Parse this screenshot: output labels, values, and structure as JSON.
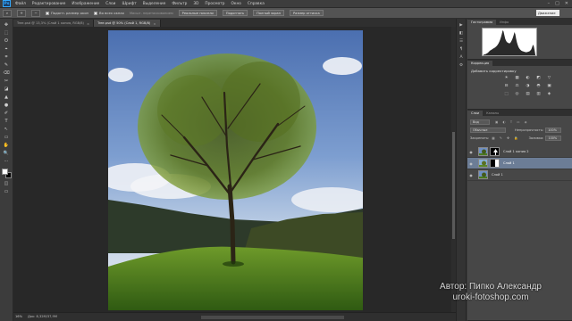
{
  "app": {
    "logo": "Ps"
  },
  "menu": [
    "Файл",
    "Редактирование",
    "Изображение",
    "Слои",
    "Шрифт",
    "Выделение",
    "Фильтр",
    "3D",
    "Просмотр",
    "Окно",
    "Справка"
  ],
  "window_controls": [
    "–",
    "□",
    "✕"
  ],
  "options_bar": {
    "tool_icon": "zoom-icon",
    "check_resize": "Подогн. размер окон",
    "check_all": "Во всех окнах",
    "scrubby_label": "Масшт. перетаскиванием",
    "btn_actual": "Реальные пиксели",
    "btn_fit": "Подогнать",
    "btn_fill": "Полный экран",
    "btn_print": "Размер оттиска",
    "workspace": "Движение"
  },
  "tools": [
    "✥",
    "⬚",
    "ʘ",
    "⌖",
    "⌗",
    "✎",
    "⌫",
    "✂",
    "◪",
    "▲",
    "●",
    "✐",
    "T",
    "↖",
    "▭",
    "✋",
    "🔍",
    "⋯"
  ],
  "tabs": [
    {
      "label": "Tree.psd @ 13,3% (Слой 1 копия, RGB/8)",
      "active": false,
      "close": "×"
    },
    {
      "label": "Tree.psd @ 50% (Слой 1, RGB/8)",
      "active": true,
      "close": "×"
    }
  ],
  "status": {
    "zoom": "16%",
    "doc": "Док: 8,32M/37,9M"
  },
  "panel_strip_icons": [
    "▶",
    "◧",
    "☰",
    "¶",
    "A",
    "⚙"
  ],
  "histogram_panel": {
    "tabs": [
      "Гистограмма",
      "Инфо"
    ],
    "levels": [
      2,
      3,
      4,
      5,
      7,
      9,
      12,
      15,
      18,
      20,
      22,
      24,
      26,
      28,
      30,
      33,
      36,
      40,
      45,
      52,
      60,
      70,
      82,
      95,
      90,
      75,
      62,
      55,
      50,
      48,
      46,
      45,
      47,
      52,
      58,
      66,
      76,
      88,
      80,
      62,
      48,
      38,
      30,
      25,
      21,
      18,
      16,
      15,
      14,
      13,
      12,
      12,
      12,
      13,
      14,
      15,
      18,
      22,
      30,
      40,
      35,
      20
    ]
  },
  "adjustments_panel": {
    "tabs": [
      "Коррекция"
    ],
    "title": "Добавить корректировку",
    "icons": [
      "☀",
      "▦",
      "◐",
      "◩",
      "▽",
      "⊟",
      "⚖",
      "◑",
      "◓",
      "▣",
      "⬚",
      "◎",
      "▤",
      "▥",
      "◈"
    ]
  },
  "layers_panel": {
    "tabs": [
      "Слои",
      "Каналы"
    ],
    "filter_label": "Вид",
    "blend_mode": "Обычные",
    "opacity_label": "Непрозрачность:",
    "opacity_value": "100%",
    "lock_label": "Закрепить:",
    "fill_label": "Заливка:",
    "fill_value": "100%",
    "eye_glyph": "◉",
    "layers": [
      {
        "name": "Слой 1 копия 2",
        "selected": false,
        "mask": "white-shape"
      },
      {
        "name": "Слой 1",
        "selected": true,
        "mask": "white-half"
      },
      {
        "name": "Слой 1",
        "selected": false,
        "mask": "none"
      }
    ]
  },
  "watermark": {
    "line1": "Автор: Пипко Александр",
    "line2": "uroki-fotoshop.com"
  },
  "colors": {
    "selection": "#6c7d96",
    "panel_bg": "#474747",
    "canvas_bg": "#282828"
  }
}
